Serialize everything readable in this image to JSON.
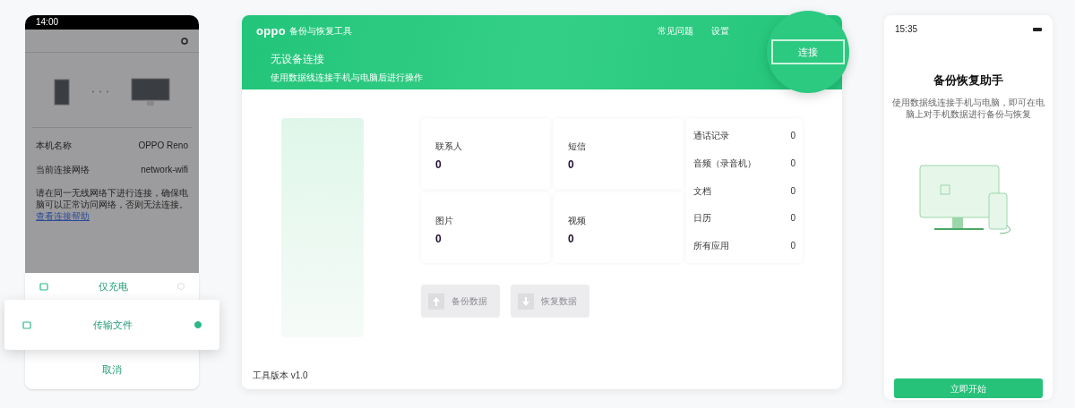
{
  "left_phone": {
    "status_time": "14:00",
    "device_rows": [
      {
        "label": "本机名称",
        "value": "OPPO Reno"
      },
      {
        "label": "当前连接网络",
        "value": "network-wifi"
      }
    ],
    "note": "请在同一无线网络下进行连接，确保电脑可以正常访问网络，否则无法连接。",
    "note_link": "查看连接帮助",
    "options": [
      {
        "label": "仅充电",
        "selected": false
      },
      {
        "label": "传输文件",
        "selected": true
      }
    ],
    "cancel": "取消"
  },
  "window": {
    "logo": "oppo",
    "title": "备份与恢复工具",
    "menu": [
      "常见问题",
      "设置"
    ],
    "banner_title": "无设备连接",
    "banner_text": "使用数据线连接手机与电脑后进行操作",
    "connect_button": "连接",
    "stats": [
      {
        "label": "联系人",
        "value": "0"
      },
      {
        "label": "短信",
        "value": "0"
      },
      {
        "label": "图片",
        "value": "0"
      },
      {
        "label": "视频",
        "value": "0"
      }
    ],
    "list": [
      {
        "label": "通话记录",
        "value": "0"
      },
      {
        "label": "音频（录音机）",
        "value": "0"
      },
      {
        "label": "文档",
        "value": "0"
      },
      {
        "label": "日历",
        "value": "0"
      },
      {
        "label": "所有应用",
        "value": "0"
      }
    ],
    "actions": [
      {
        "label": "备份数据",
        "kind": "up",
        "disabled": true
      },
      {
        "label": "恢复数据",
        "kind": "down",
        "disabled": true
      }
    ],
    "version": "工具版本 v1.0"
  },
  "right_phone": {
    "status_time": "15:35",
    "title": "备份恢复助手",
    "text": "使用数据线连接手机与电脑，即可在电脑上对手机数据进行备份与恢复",
    "button": "立即开始"
  }
}
